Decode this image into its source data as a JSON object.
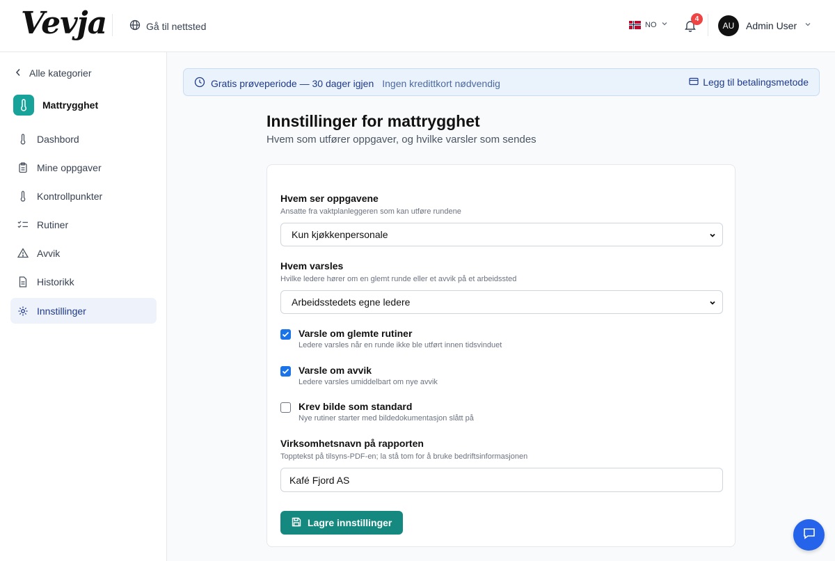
{
  "header": {
    "logo": "Vevja",
    "goto_site": "Gå til nettsted",
    "language": "NO",
    "notification_count": "4",
    "avatar_initials": "AU",
    "user_name": "Admin User"
  },
  "sidebar": {
    "back_label": "Alle kategorier",
    "category_name": "Mattrygghet",
    "items": [
      {
        "label": "Dashbord",
        "icon": "thermometer-icon"
      },
      {
        "label": "Mine oppgaver",
        "icon": "clipboard-icon"
      },
      {
        "label": "Kontrollpunkter",
        "icon": "thermometer-icon"
      },
      {
        "label": "Rutiner",
        "icon": "checklist-icon"
      },
      {
        "label": "Avvik",
        "icon": "warning-icon"
      },
      {
        "label": "Historikk",
        "icon": "document-icon"
      },
      {
        "label": "Innstillinger",
        "icon": "gear-icon",
        "active": true
      }
    ]
  },
  "banner": {
    "title": "Gratis prøveperiode — 30 dager igjen",
    "subtitle": "Ingen kredittkort nødvendig",
    "action": "Legg til betalingsmetode"
  },
  "page": {
    "title": "Innstillinger for mattrygghet",
    "subtitle": "Hvem som utfører oppgaver, og hvilke varsler som sendes"
  },
  "form": {
    "who_sees": {
      "label": "Hvem ser oppgavene",
      "help": "Ansatte fra vaktplanleggeren som kan utføre rundene",
      "value": "Kun kjøkkenpersonale"
    },
    "who_notified": {
      "label": "Hvem varsles",
      "help": "Hvilke ledere hører om en glemt runde eller et avvik på et arbeidssted",
      "value": "Arbeidsstedets egne ledere"
    },
    "checks": [
      {
        "title": "Varsle om glemte rutiner",
        "sub": "Ledere varsles når en runde ikke ble utført innen tidsvinduet",
        "checked": true
      },
      {
        "title": "Varsle om avvik",
        "sub": "Ledere varsles umiddelbart om nye avvik",
        "checked": true
      },
      {
        "title": "Krev bilde som standard",
        "sub": "Nye rutiner starter med bildedokumentasjon slått på",
        "checked": false
      }
    ],
    "company_name": {
      "label": "Virksomhetsnavn på rapporten",
      "help": "Topptekst på tilsyns-PDF-en; la stå tom for å bruke bedriftsinformasjonen",
      "value": "Kafé Fjord AS"
    },
    "save_label": "Lagre innstillinger"
  },
  "colors": {
    "accent_teal": "#15897f",
    "checkbox_blue": "#1a73e8",
    "badge_red": "#ef4444",
    "chat_blue": "#2563eb"
  }
}
